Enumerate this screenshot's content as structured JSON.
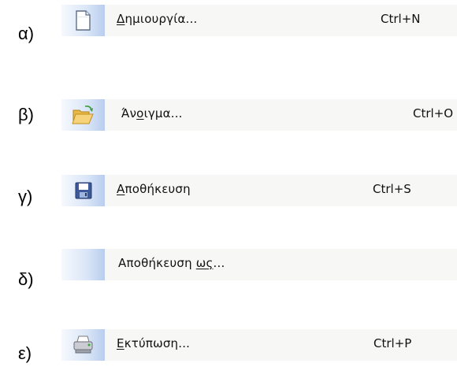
{
  "rows": [
    {
      "marker": "α)",
      "label_pre": "",
      "label_accel": "Δ",
      "label_post": "ημιουργία...",
      "shortcut": "Ctrl+N",
      "icon": "new-document-icon"
    },
    {
      "marker": "β)",
      "label_pre": "Άν",
      "label_accel": "ο",
      "label_post": "ιγμα...",
      "shortcut": "Ctrl+O",
      "icon": "open-folder-icon"
    },
    {
      "marker": "γ)",
      "label_pre": "",
      "label_accel": "Α",
      "label_post": "ποθήκευση",
      "shortcut": "Ctrl+S",
      "icon": "save-floppy-icon"
    },
    {
      "marker": "δ)",
      "label_pre": "Αποθήκευση ",
      "label_accel": "ως",
      "label_post": "...",
      "shortcut": "",
      "icon": ""
    },
    {
      "marker": "ε)",
      "label_pre": "",
      "label_accel": "Ε",
      "label_post": "κτύπωση...",
      "shortcut": "Ctrl+P",
      "icon": "printer-icon"
    }
  ]
}
